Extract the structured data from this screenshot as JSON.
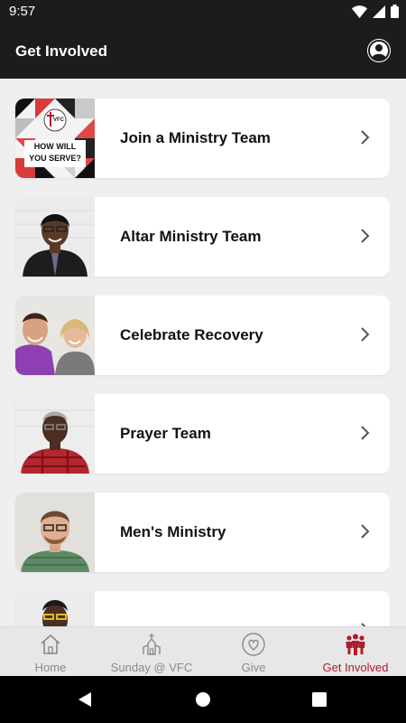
{
  "status_bar": {
    "time": "9:57"
  },
  "app_bar": {
    "title": "Get Involved",
    "profile_icon": "account-circle-icon"
  },
  "cards": [
    {
      "label": "Join a Ministry Team",
      "thumb_text_line1": "HOW WILL",
      "thumb_text_line2": "YOU SERVE?",
      "thumb_logo": "VFC"
    },
    {
      "label": "Altar Ministry Team"
    },
    {
      "label": "Celebrate Recovery"
    },
    {
      "label": "Prayer Team"
    },
    {
      "label": "Men's Ministry"
    },
    {
      "label": ""
    }
  ],
  "bottom_nav": {
    "items": [
      {
        "label": "Home",
        "icon": "home-icon"
      },
      {
        "label": "Sunday @ VFC",
        "icon": "church-icon"
      },
      {
        "label": "Give",
        "icon": "heart-icon"
      },
      {
        "label": "Get Involved",
        "icon": "people-icon",
        "active": true
      }
    ],
    "active_color": "#b01c2e",
    "inactive_color": "#8a8a8a"
  },
  "colors": {
    "header_bg": "#1c1c1c",
    "page_bg": "#efefef",
    "accent": "#b01c2e"
  }
}
